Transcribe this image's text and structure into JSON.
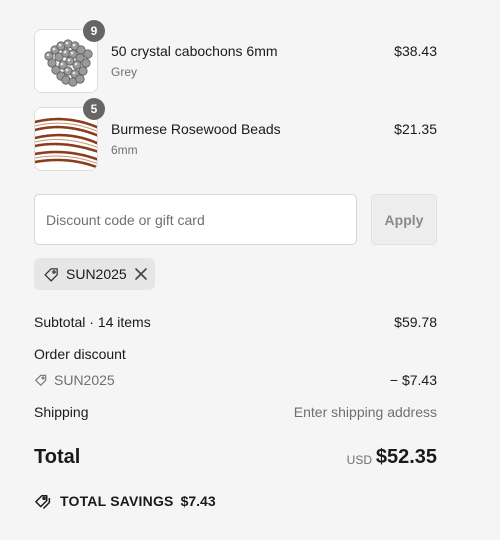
{
  "cart": {
    "items": [
      {
        "name": "50 crystal cabochons 6mm",
        "variant": "Grey",
        "price": "$38.43",
        "quantity": "9",
        "image_icon": "crystal-cabochons-thumbnail"
      },
      {
        "name": "Burmese Rosewood Beads",
        "variant": "6mm",
        "price": "$21.35",
        "quantity": "5",
        "image_icon": "rosewood-beads-thumbnail"
      }
    ]
  },
  "discount": {
    "placeholder": "Discount code or gift card",
    "value": "",
    "apply_label": "Apply",
    "applied_code": "SUN2025",
    "tag_icon": "tag-icon",
    "remove_icon": "close-icon"
  },
  "summary": {
    "subtotal_label": "Subtotal · 14 items",
    "subtotal_value": "$59.78",
    "order_discount_label": "Order discount",
    "discount_code": "SUN2025",
    "discount_value": "− $7.43",
    "shipping_label": "Shipping",
    "shipping_value": "Enter shipping address",
    "total_label": "Total",
    "currency": "USD",
    "total_value": "$52.35",
    "savings_label": "TOTAL SAVINGS",
    "savings_value": "$7.43",
    "savings_icon": "tags-icon"
  },
  "colors": {
    "background": "#f5f5f5",
    "text": "#1a1a1a",
    "muted": "#707070",
    "badge": "#666666",
    "chip": "#e6e6e6"
  }
}
